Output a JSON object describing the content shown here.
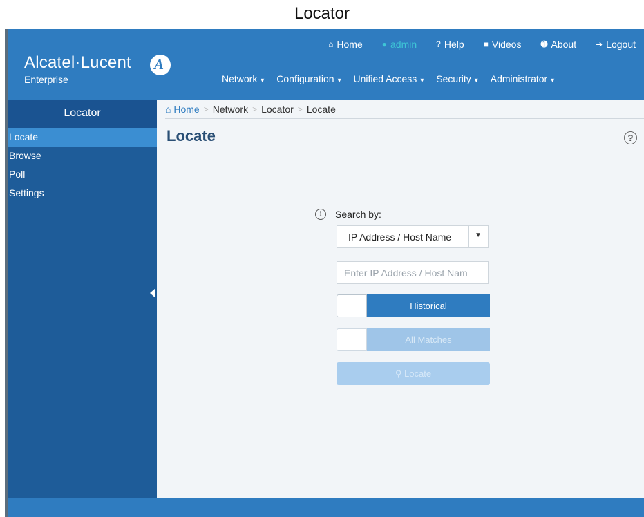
{
  "caption": "Locator",
  "header": {
    "brand_name": "Alcatel·Lucent",
    "brand_sub": "Enterprise",
    "top_links": [
      {
        "label": "Home",
        "icon": "home-icon"
      },
      {
        "label": "admin",
        "icon": "user-icon"
      },
      {
        "label": "Help",
        "icon": "question-icon"
      },
      {
        "label": "Videos",
        "icon": "video-icon"
      },
      {
        "label": "About",
        "icon": "info-icon"
      },
      {
        "label": "Logout",
        "icon": "logout-icon"
      }
    ],
    "nav": [
      "Network",
      "Configuration",
      "Unified Access",
      "Security",
      "Administrator"
    ]
  },
  "sidebar": {
    "title": "Locator",
    "items": [
      {
        "label": "Locate",
        "active": true
      },
      {
        "label": "Browse"
      },
      {
        "label": "Poll"
      },
      {
        "label": "Settings"
      }
    ]
  },
  "breadcrumb": [
    "Home",
    "Network",
    "Locator",
    "Locate"
  ],
  "page": {
    "title": "Locate",
    "help_symbol": "?"
  },
  "form": {
    "info_symbol": "i",
    "search_by_label": "Search by:",
    "search_by_value": "IP Address / Host Name",
    "input_placeholder": "Enter IP Address / Host Nam",
    "historical_label": "Historical",
    "all_matches_label": "All Matches",
    "locate_label": "Locate"
  },
  "colors": {
    "header": "#2f7cc0",
    "sidebar": "#1e5c99",
    "active_item": "#3b8ed2",
    "admin_link": "#3ec6d6",
    "title": "#2a4f75"
  }
}
